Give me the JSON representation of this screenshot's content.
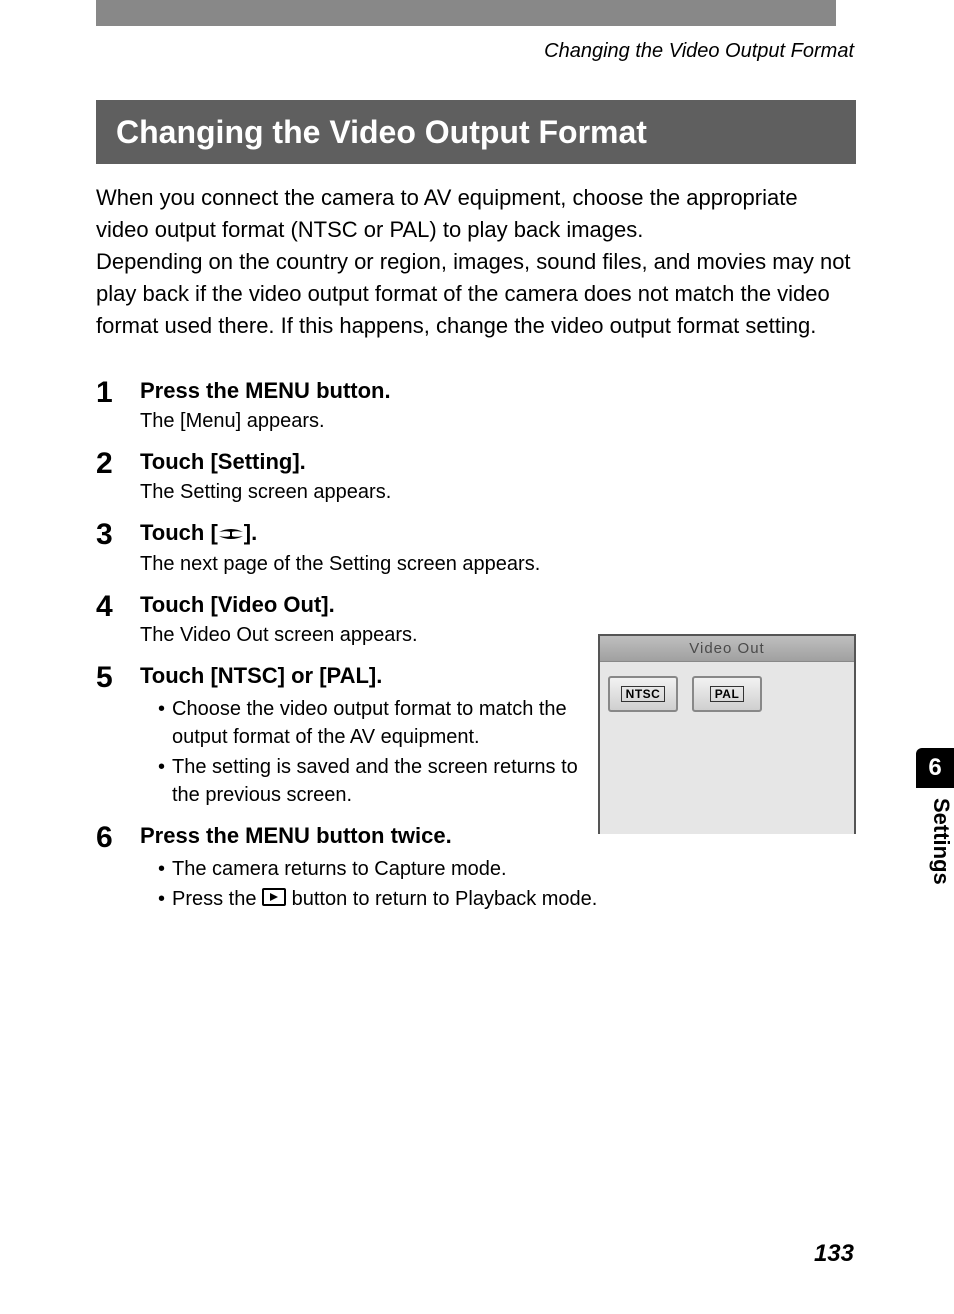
{
  "running_head": "Changing the Video Output Format",
  "section_title": "Changing the Video Output Format",
  "intro": "When you connect the camera to AV equipment, choose the appropriate video output format (NTSC or PAL) to play back images.\nDepending on the country or region, images, sound files, and movies may not play back if the video output format of the camera does not match the video format used there. If this happens, change the video output format setting.",
  "steps": {
    "s1": {
      "num": "1",
      "title_a": "Press the ",
      "title_menu": "MENU",
      "title_b": " button.",
      "desc": "The [Menu] appears."
    },
    "s2": {
      "num": "2",
      "title": "Touch [Setting].",
      "desc": "The Setting screen appears."
    },
    "s3": {
      "num": "3",
      "title_a": "Touch [",
      "title_b": "].",
      "desc": "The next page of the Setting screen appears."
    },
    "s4": {
      "num": "4",
      "title": "Touch [Video Out].",
      "desc": "The Video Out screen appears."
    },
    "s5": {
      "num": "5",
      "title": "Touch [NTSC] or [PAL].",
      "b1": "Choose the video output format to match the output format of the AV equipment.",
      "b2": "The setting is saved and the screen returns to the previous screen."
    },
    "s6": {
      "num": "6",
      "title_a": "Press the ",
      "title_menu": "MENU",
      "title_b": " button twice.",
      "b1": "The camera returns to Capture mode.",
      "b2a": "Press the ",
      "b2b": " button to return to Playback mode."
    }
  },
  "screen": {
    "title": "Video Out",
    "btn_ntsc": "NTSC",
    "btn_pal": "PAL"
  },
  "side_tab": {
    "num": "6",
    "label": "Settings"
  },
  "page_number": "133"
}
